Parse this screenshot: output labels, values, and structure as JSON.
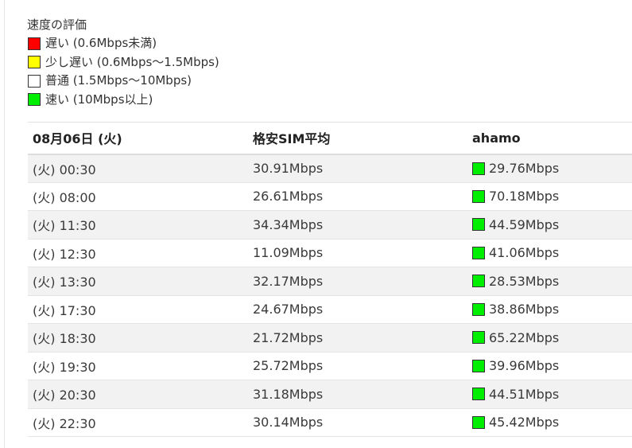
{
  "legend": {
    "title": "速度の評価",
    "items": [
      {
        "label": "遅い (0.6Mbps未満)",
        "color": "#ff0000"
      },
      {
        "label": "少し遅い (0.6Mbps〜1.5Mbps)",
        "color": "#ffff00"
      },
      {
        "label": "普通 (1.5Mbps〜10Mbps)",
        "color": "#ffffff"
      },
      {
        "label": "速い (10Mbps以上)",
        "color": "#00ee00"
      }
    ]
  },
  "table": {
    "headers": [
      "08月06日 (火)",
      "格安SIM平均",
      "ahamo"
    ],
    "rows": [
      {
        "time": "(火) 00:30",
        "avg": "30.91Mbps",
        "ahamo": "29.76Mbps",
        "rating_color": "#00ee00"
      },
      {
        "time": "(火) 08:00",
        "avg": "26.61Mbps",
        "ahamo": "70.18Mbps",
        "rating_color": "#00ee00"
      },
      {
        "time": "(火) 11:30",
        "avg": "34.34Mbps",
        "ahamo": "44.59Mbps",
        "rating_color": "#00ee00"
      },
      {
        "time": "(火) 12:30",
        "avg": "11.09Mbps",
        "ahamo": "41.06Mbps",
        "rating_color": "#00ee00"
      },
      {
        "time": "(火) 13:30",
        "avg": "32.17Mbps",
        "ahamo": "28.53Mbps",
        "rating_color": "#00ee00"
      },
      {
        "time": "(火) 17:30",
        "avg": "24.67Mbps",
        "ahamo": "38.86Mbps",
        "rating_color": "#00ee00"
      },
      {
        "time": "(火) 18:30",
        "avg": "21.72Mbps",
        "ahamo": "65.22Mbps",
        "rating_color": "#00ee00"
      },
      {
        "time": "(火) 19:30",
        "avg": "25.72Mbps",
        "ahamo": "39.96Mbps",
        "rating_color": "#00ee00"
      },
      {
        "time": "(火) 20:30",
        "avg": "31.18Mbps",
        "ahamo": "44.51Mbps",
        "rating_color": "#00ee00"
      },
      {
        "time": "(火) 22:30",
        "avg": "30.14Mbps",
        "ahamo": "45.42Mbps",
        "rating_color": "#00ee00"
      }
    ]
  }
}
